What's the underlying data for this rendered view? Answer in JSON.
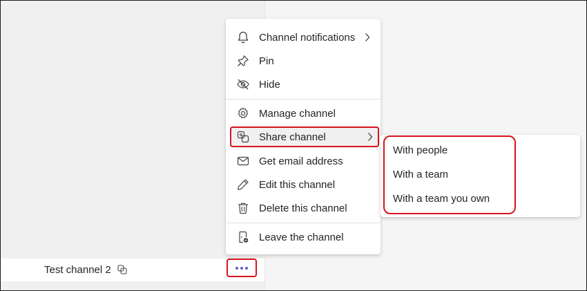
{
  "channel": {
    "name": "Test channel 2",
    "share_icon": "shared-channel-icon",
    "more_icon": "more-options-icon"
  },
  "menu": {
    "items": [
      {
        "id": "notifications",
        "label": "Channel notifications",
        "icon": "bell-icon",
        "has_submenu": true
      },
      {
        "id": "pin",
        "label": "Pin",
        "icon": "pin-icon",
        "has_submenu": false
      },
      {
        "id": "hide",
        "label": "Hide",
        "icon": "eye-off-icon",
        "has_submenu": false
      },
      {
        "id": "manage",
        "label": "Manage channel",
        "icon": "gear-icon",
        "has_submenu": false
      },
      {
        "id": "share",
        "label": "Share channel",
        "icon": "share-channel-icon",
        "has_submenu": true,
        "highlighted": true
      },
      {
        "id": "email",
        "label": "Get email address",
        "icon": "mail-icon",
        "has_submenu": false
      },
      {
        "id": "edit",
        "label": "Edit this channel",
        "icon": "pencil-icon",
        "has_submenu": false
      },
      {
        "id": "delete",
        "label": "Delete this channel",
        "icon": "trash-icon",
        "has_submenu": false
      },
      {
        "id": "leave",
        "label": "Leave the channel",
        "icon": "leave-channel-icon",
        "has_submenu": false
      }
    ]
  },
  "submenu": {
    "items": [
      {
        "label": "With people"
      },
      {
        "label": "With a team"
      },
      {
        "label": "With a team you own"
      }
    ]
  },
  "colors": {
    "highlight_border": "#d6131b",
    "accent": "#5b5fc7",
    "text": "#242424"
  }
}
